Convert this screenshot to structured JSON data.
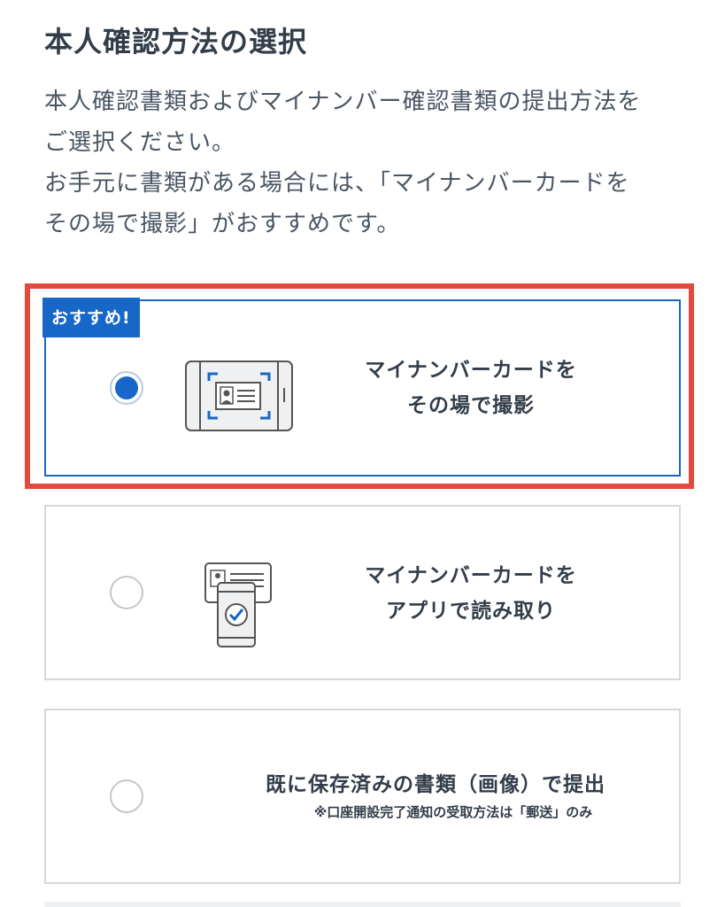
{
  "page": {
    "title": "本人確認方法の選択",
    "description": [
      "本人確認書類およびマイナンバー確認書類の提出方法を",
      "ご選択ください。",
      "お手元に書類がある場合には、「マイナンバーカードを",
      "その場で撮影」がおすすめです。"
    ]
  },
  "options": [
    {
      "badge": "おすすめ!",
      "label_line1": "マイナンバーカードを",
      "label_line2": "その場で撮影",
      "selected": true,
      "icon": "card-scan-icon"
    },
    {
      "label_line1": "マイナンバーカードを",
      "label_line2": "アプリで読み取り",
      "selected": false,
      "icon": "phone-card-check-icon"
    },
    {
      "label_line1": "既に保存済みの書類（画像）で提出",
      "note": "※口座開設完了通知の受取方法は「郵送」のみ",
      "selected": false
    }
  ],
  "colors": {
    "accent": "#1767c9",
    "highlight": "#e24a3d",
    "border": "#d4d7db",
    "text": "#333d49"
  }
}
